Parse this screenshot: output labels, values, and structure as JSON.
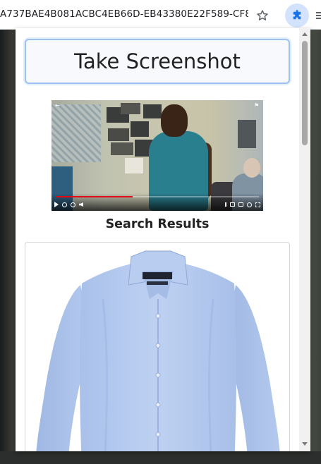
{
  "browser": {
    "url_text": "A737BAE4B081ACBC4EB66D-EB43380E22F589-CF8...",
    "star_icon": "star-outline-icon",
    "extension_icon": "puzzle-piece-icon",
    "extension_active_color": "#d3e3fd",
    "extension_icon_color": "#1a73e8"
  },
  "popup": {
    "screenshot_button_label": "Take Screenshot",
    "results_heading": "Search Results",
    "video_thumbnail": {
      "progress_fraction": 0.38,
      "progress_color": "#e50914"
    },
    "results": [
      {
        "image": "light-blue-dress-shirt"
      }
    ]
  }
}
